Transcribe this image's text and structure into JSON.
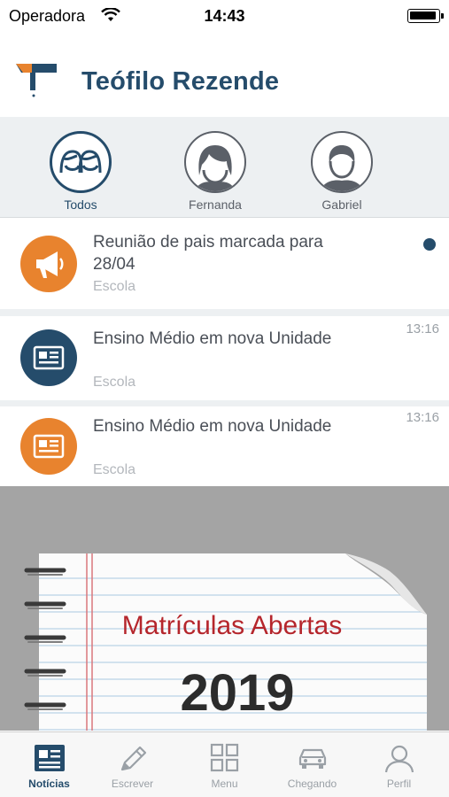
{
  "status_bar": {
    "carrier": "Operadora",
    "time": "14:43"
  },
  "header": {
    "title": "Teófilo Rezende"
  },
  "filters": [
    {
      "label": "Todos",
      "active": true
    },
    {
      "label": "Fernanda",
      "active": false
    },
    {
      "label": "Gabriel",
      "active": false
    }
  ],
  "notifications": [
    {
      "title": "Reunião de pais marcada para 28/04",
      "source": "Escola",
      "time": "",
      "unread": true,
      "icon": "megaphone-icon",
      "color": "#e8832e"
    },
    {
      "title": "Ensino Médio em nova Unidade",
      "source": "Escola",
      "time": "13:16",
      "unread": false,
      "icon": "newspaper-icon",
      "color": "#254c6b"
    },
    {
      "title": "Ensino Médio em nova Unidade",
      "source": "Escola",
      "time": "13:16",
      "unread": false,
      "icon": "newspaper-icon",
      "color": "#e8832e"
    }
  ],
  "banner": {
    "headline": "Matrículas Abertas",
    "year": "2019"
  },
  "tabbar": [
    {
      "label": "Notícias",
      "icon": "newspaper-icon",
      "active": true
    },
    {
      "label": "Escrever",
      "icon": "pencil-icon",
      "active": false
    },
    {
      "label": "Menu",
      "icon": "grid-icon",
      "active": false
    },
    {
      "label": "Chegando",
      "icon": "car-icon",
      "active": false
    },
    {
      "label": "Perfil",
      "icon": "user-icon",
      "active": false
    }
  ],
  "colors": {
    "primary": "#254c6b",
    "accent": "#e8832e",
    "banner_red": "#b5262c"
  }
}
